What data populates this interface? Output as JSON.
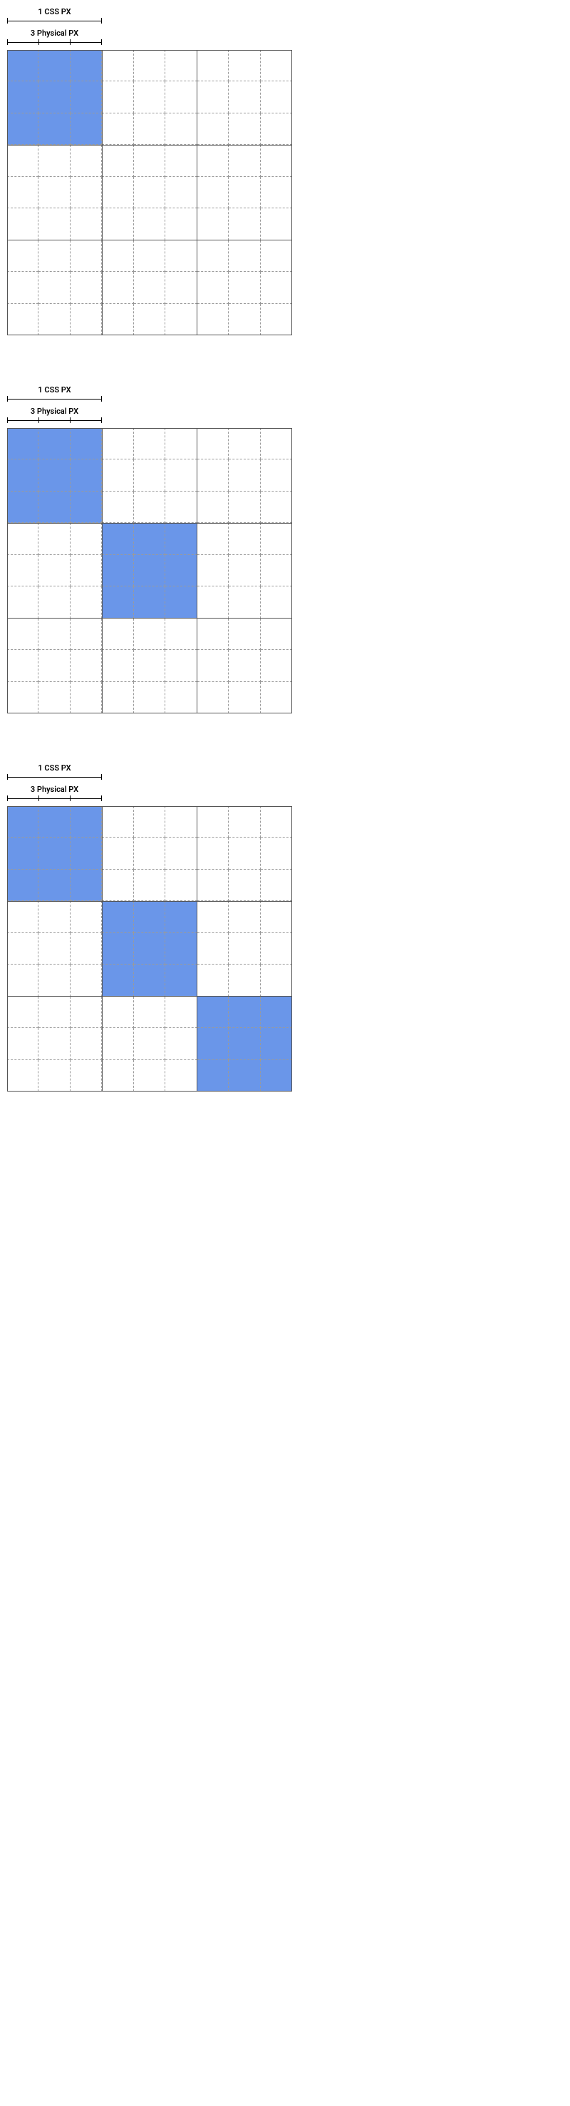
{
  "labels": {
    "css_px": "1 CSS PX",
    "physical_px": "3 Physical PX"
  },
  "colors": {
    "fill": "#6a96e9",
    "grid_major": "#555555",
    "grid_minor": "#9a9a9a"
  },
  "grid": {
    "css_pixels_per_side": 3,
    "physical_pixels_per_side": 9,
    "device_pixel_ratio": 3
  },
  "figures": [
    {
      "id": "figure-1",
      "filled_css_pixels": [
        [
          0,
          0
        ]
      ]
    },
    {
      "id": "figure-2",
      "filled_css_pixels": [
        [
          0,
          0
        ],
        [
          1,
          1
        ]
      ]
    },
    {
      "id": "figure-3",
      "filled_css_pixels": [
        [
          0,
          0
        ],
        [
          1,
          1
        ],
        [
          2,
          2
        ]
      ]
    }
  ]
}
